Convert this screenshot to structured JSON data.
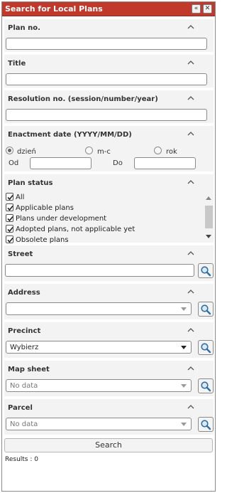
{
  "panel": {
    "title": "Search for Local Plans",
    "collapse_icon": "double-chevron-left-icon",
    "close_icon": "close-icon"
  },
  "sections": {
    "plan_no": {
      "title": "Plan no.",
      "value": ""
    },
    "title": {
      "title": "Title",
      "value": ""
    },
    "resolution": {
      "title": "Resolution no. (session/number/year)",
      "value": ""
    },
    "enactment": {
      "title": "Enactment date (YYYY/MM/DD)",
      "options": [
        "dzień",
        "m-c",
        "rok"
      ],
      "selected": "dzień",
      "from_label": "Od",
      "to_label": "Do",
      "from_value": "",
      "to_value": ""
    },
    "plan_status": {
      "title": "Plan status",
      "items": [
        {
          "label": "All",
          "checked": true
        },
        {
          "label": "Applicable plans",
          "checked": true
        },
        {
          "label": "Plans under development",
          "checked": true
        },
        {
          "label": "Adopted plans, not applicable yet",
          "checked": true
        },
        {
          "label": "Obsolete plans",
          "checked": true
        }
      ]
    },
    "street": {
      "title": "Street",
      "value": ""
    },
    "address": {
      "title": "Address",
      "value": ""
    },
    "precinct": {
      "title": "Precinct",
      "value": "Wybierz"
    },
    "map_sheet": {
      "title": "Map sheet",
      "placeholder": "No data"
    },
    "parcel": {
      "title": "Parcel",
      "placeholder": "No data"
    }
  },
  "search_button": "Search",
  "results": "Results : 0",
  "colors": {
    "title_bar": "#c0392b",
    "section_bg": "#f3f3f3",
    "search_icon": "#2e6fa7"
  }
}
